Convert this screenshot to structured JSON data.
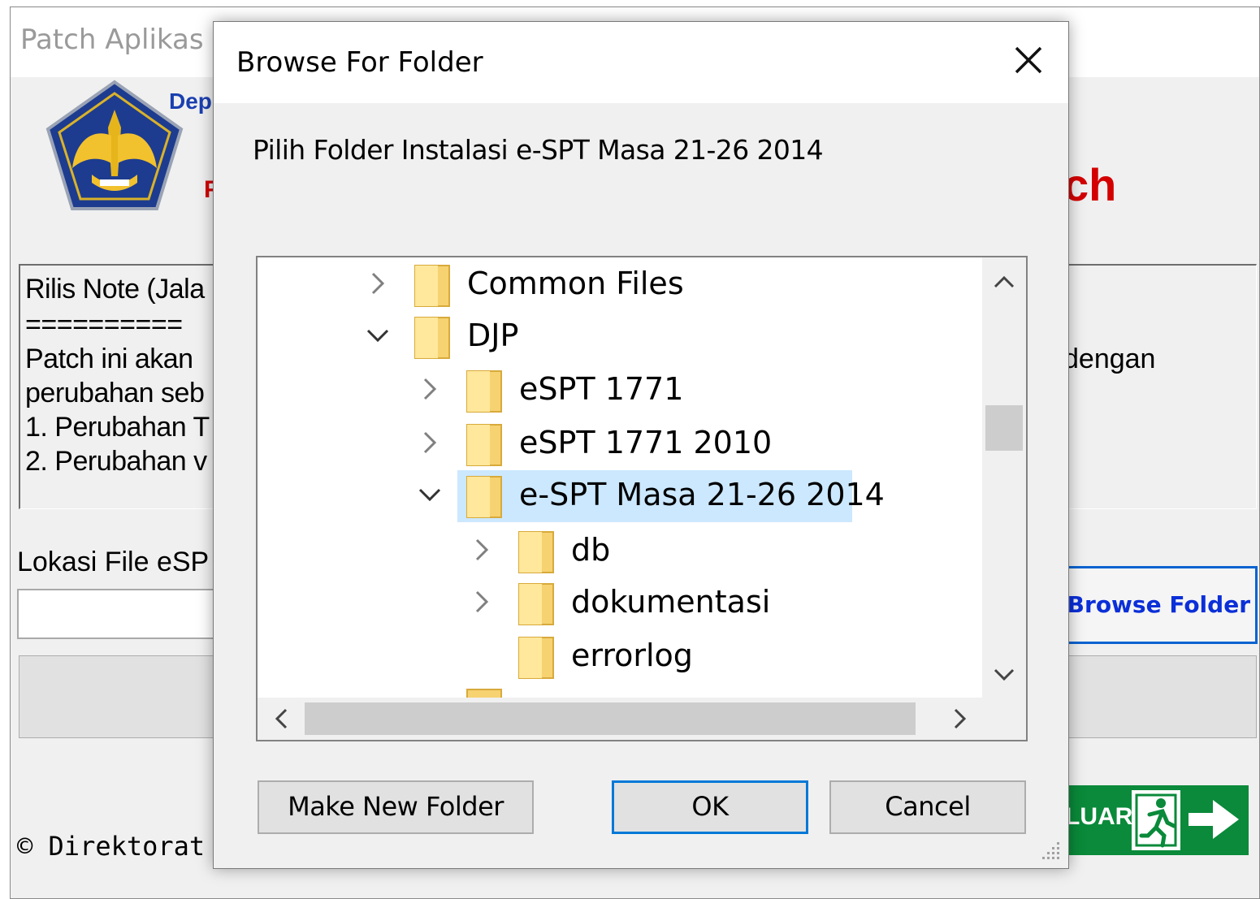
{
  "app": {
    "title": "Patch Aplikas",
    "dep_text": "Dep",
    "header_left_fragment": "F",
    "header_right_fragment": "ch",
    "notes": [
      "Rilis Note (Jala",
      "==========",
      "Patch ini akan",
      "perubahan seb",
      "1. Perubahan T",
      "2. Perubahan v"
    ],
    "notes_right": "dengan",
    "location_label": "Lokasi File eSP",
    "browse_button": "Browse Folder",
    "exit_button": "LUAR",
    "copyright": "© Direktorat"
  },
  "dialog": {
    "title": "Browse For Folder",
    "description": "Pilih Folder Instalasi e-SPT Masa 21-26 2014",
    "tree": [
      {
        "label": "Common Files",
        "level": 0,
        "state": "collapsed"
      },
      {
        "label": "DJP",
        "level": 0,
        "state": "expanded"
      },
      {
        "label": "eSPT 1771",
        "level": 1,
        "state": "collapsed"
      },
      {
        "label": "eSPT 1771 2010",
        "level": 1,
        "state": "collapsed"
      },
      {
        "label": "e-SPT Masa 21-26 2014",
        "level": 1,
        "state": "expanded",
        "selected": true
      },
      {
        "label": "db",
        "level": 2,
        "state": "collapsed"
      },
      {
        "label": "dokumentasi",
        "level": 2,
        "state": "collapsed"
      },
      {
        "label": "errorlog",
        "level": 2,
        "state": "leaf"
      }
    ],
    "buttons": {
      "make_new_folder": "Make New Folder",
      "ok": "OK",
      "cancel": "Cancel"
    }
  },
  "colors": {
    "selection": "#cce8ff",
    "folder": "#f6d271",
    "focus_border": "#0078d7",
    "browse_text": "#0b2fd8",
    "header_red": "#d40000",
    "exit_green": "#0a8a3a"
  }
}
